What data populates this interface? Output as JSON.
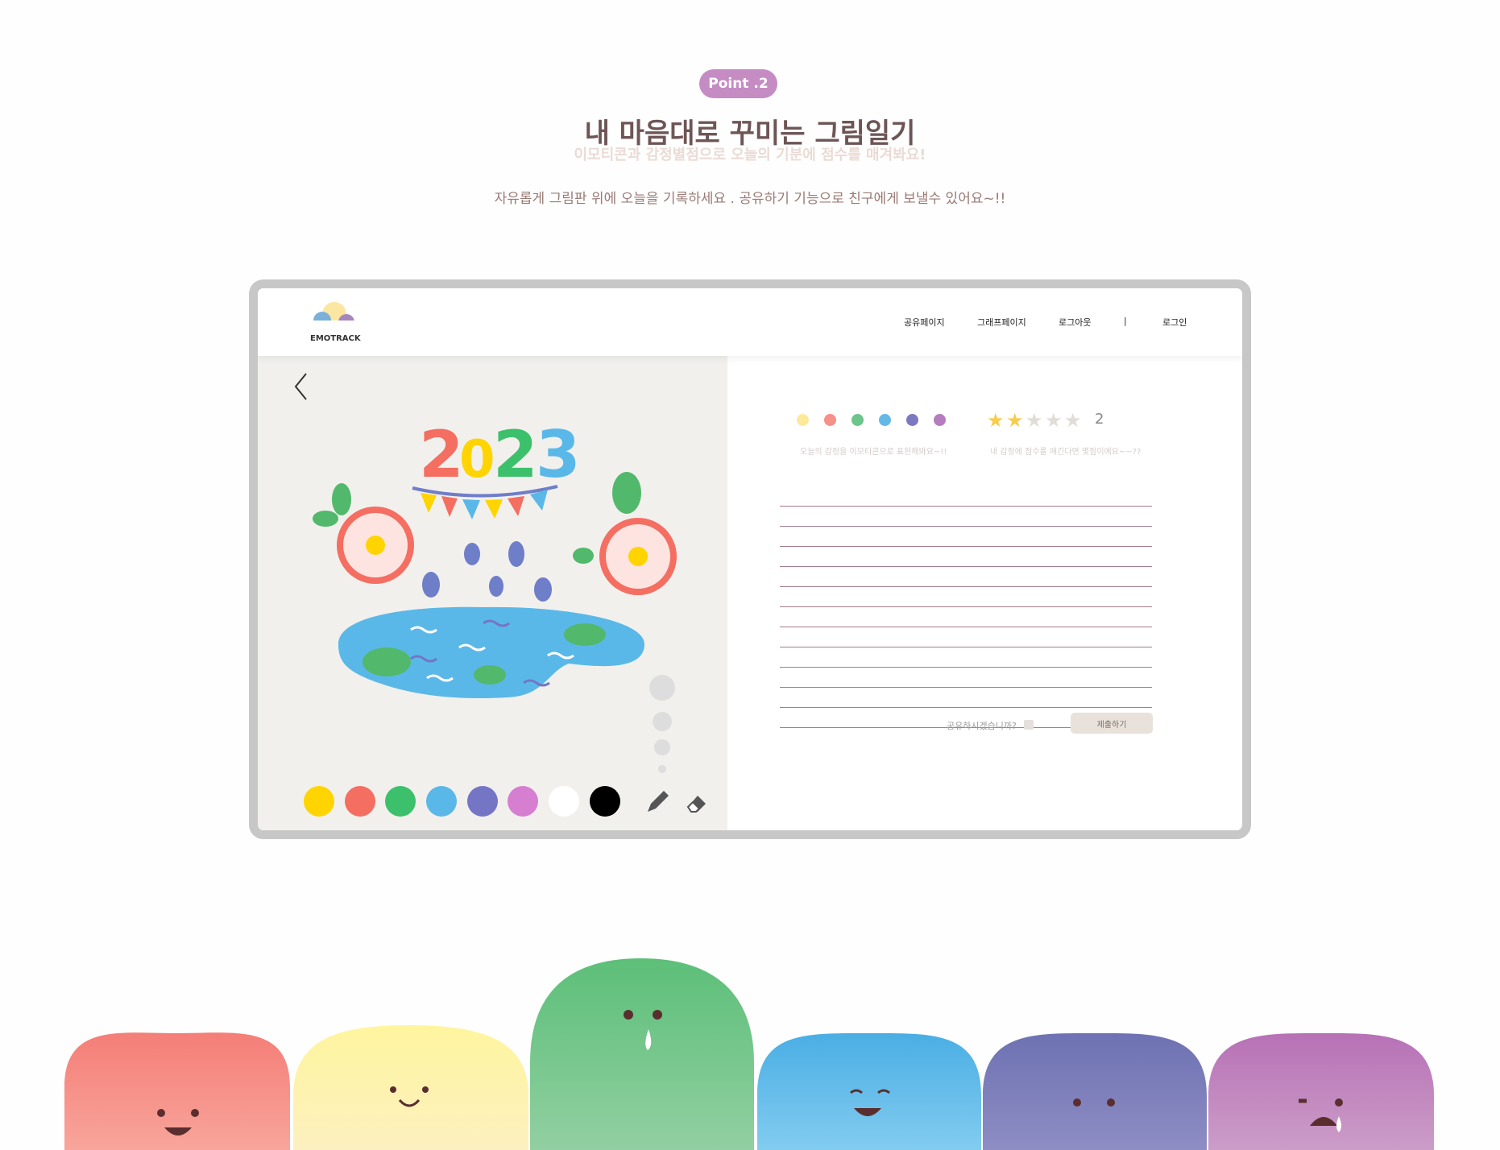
{
  "badge": "Point .2",
  "heading": {
    "title": "내 마음대로 꾸미는 그림일기",
    "subtitle": "이모티콘과 감정별점으로 오늘의 기분에 점수를 매겨봐요!",
    "description": "자유롭게 그림판 위에 오늘을 기록하세요 . 공유하기 기능으로 친구에게 보낼수 있어요~!!"
  },
  "app": {
    "logo_text": "EMOTRACK",
    "nav": [
      "공유페이지",
      "그래프페이지",
      "로그아웃",
      "|",
      "로그인"
    ],
    "rating_value": "2",
    "emotion_hint": "오늘의 감정을 이모티콘으로 표현해봐요~!!",
    "rating_hint": "내 감정에 점수를 매긴다면 몇점이에요~~??",
    "share_label": "공유하시겠습니까?",
    "submit_label": "제출하기"
  },
  "drawing": {
    "year_text": "2023"
  },
  "colors": {
    "palette": [
      "#ffd400",
      "#f46e62",
      "#3dc06b",
      "#5ab8e8",
      "#7475c5",
      "#d67ed0",
      "#ffffff",
      "#000000"
    ],
    "emotions": [
      "#fde99b",
      "#f6908a",
      "#6cc58a",
      "#63b8e6",
      "#7d79c0",
      "#b57cbf"
    ],
    "star_filled": "#f7cc4f",
    "star_empty": "#e0dcd6"
  },
  "icons": [
    "back-arrow-icon",
    "pen-icon",
    "eraser-icon",
    "star-icon"
  ],
  "rating_stars": 2,
  "rating_max": 5
}
